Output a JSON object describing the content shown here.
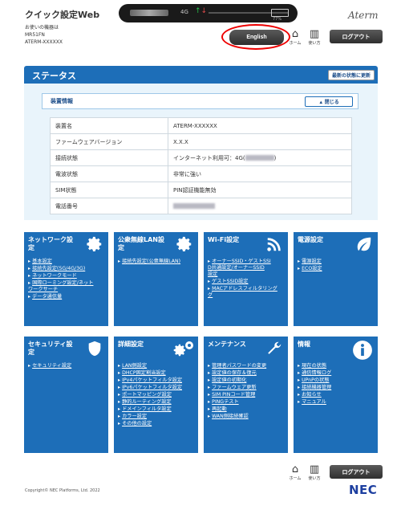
{
  "header": {
    "app_title": "クイック設定Web",
    "device_label": "お使いの機器は",
    "device_model": "MR51FN",
    "device_name": "ATERM-XXXXXX",
    "network_type": "4G",
    "battery_label": "77%",
    "brand_logo": "Aterm",
    "english_label": "English",
    "home_label": "ホーム",
    "usage_label": "使い方",
    "logout_label": "ログアウト"
  },
  "status": {
    "title": "ステータス",
    "refresh_label": "最新の状態に更新",
    "device_info_title": "装置情報",
    "close_label": "閉じる",
    "rows": [
      {
        "label": "装置名",
        "value": "ATERM-XXXXXX"
      },
      {
        "label": "ファームウェアバージョン",
        "value": "X.X.X"
      },
      {
        "label": "接続状態",
        "value": "インターネット利用可：4G("
      },
      {
        "label": "電波状態",
        "value": "非常に強い"
      },
      {
        "label": "SIM状態",
        "value": "PIN認証機能無効"
      },
      {
        "label": "電話番号",
        "value": ""
      }
    ],
    "conn_suffix": ")"
  },
  "tiles": [
    {
      "title": "ネットワーク設\n定",
      "icon": "gear-icon",
      "links": [
        "基本設定",
        "接続先設定(5G/4G/3G)",
        "ネットワークモード",
        "国際ローミング設定/ネット\nワークサーチ",
        "データ通信量"
      ]
    },
    {
      "title": "公衆無線LAN設\n定",
      "icon": "gear-icon",
      "links": [
        "接続先設定(公衆無線LAN)"
      ]
    },
    {
      "title": "Wi-Fi設定",
      "icon": "wifi-icon",
      "links": [
        "オーナーSSID・ゲストSSI\nD共通設定/オーナーSSID\n設定",
        "ゲストSSID設定",
        "MACアドレスフィルタリング\nグ"
      ]
    },
    {
      "title": "電源設定",
      "icon": "leaf-icon",
      "links": [
        "電源設定",
        "ECO設定"
      ]
    },
    {
      "title": "セキュリティ設\n定",
      "icon": "shield-icon",
      "links": [
        "セキュリティ設定"
      ]
    },
    {
      "title": "詳細設定",
      "icon": "gears-icon",
      "links": [
        "LAN側設定",
        "DHCP固定割当設定",
        "IPv4パケットフィルタ設定",
        "IPv6パケットフィルタ設定",
        "ポートマッピング設定",
        "静的ルーティング設定",
        "ドメインフィルタ設定",
        "カラー設定",
        "その他の設定"
      ]
    },
    {
      "title": "メンテナンス",
      "icon": "wrench-icon",
      "links": [
        "管理者パスワードの変更",
        "設定値の保存＆復元",
        "設定値の初期化",
        "ファームウェア更新",
        "SIM PINコード管理",
        "PINGテスト",
        "再起動",
        "WAN側接続確認"
      ]
    },
    {
      "title": "情報",
      "icon": "info-icon",
      "links": [
        "現在の状態",
        "通信情報ログ",
        "UPnPの状態",
        "接続機器管理",
        "お知らせ",
        "マニュアル"
      ]
    }
  ],
  "footer": {
    "home_label": "ホーム",
    "usage_label": "使い方",
    "logout_label": "ログアウト",
    "copyright": "Copyright© NEC Platforms, Ltd. 2022",
    "nec_logo": "NEC"
  },
  "colors": {
    "primary": "#1d6eb8",
    "panel_bg": "#e9f4fb",
    "highlight_ring": "#e00000"
  }
}
